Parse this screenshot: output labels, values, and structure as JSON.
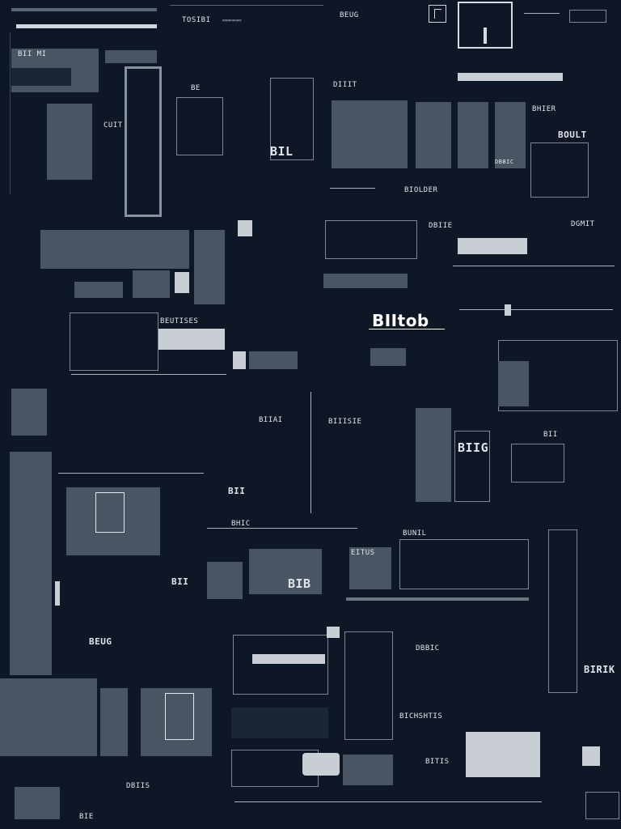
{
  "labels": {
    "l1": "TOSIBI",
    "l2": "BII MI",
    "l3": "BE",
    "l4": "CUIT",
    "l5": "BIL",
    "l6": "DIIIT",
    "l7": "BHIER",
    "l8": "BOULT",
    "l9": "BIOLDER",
    "l10": "DGMIT",
    "l11": "BIItob",
    "l12": "BEUTISES",
    "l13": "BIIAI",
    "l14": "BIIISIE",
    "l15": "BIIG",
    "l16": "BII",
    "l17": "BHIC",
    "l18": "BUNIL",
    "l19": "BIB",
    "l20": "BII",
    "l21": "BEUG",
    "l22": "DBBIC",
    "l23": "BICHSHTIS",
    "l24": "BIRIK",
    "l25": "EITUS",
    "l26": "BII",
    "l27": "BITIS",
    "l28": "BIE",
    "l29": "DBIIS",
    "l30": "DBIIE"
  }
}
